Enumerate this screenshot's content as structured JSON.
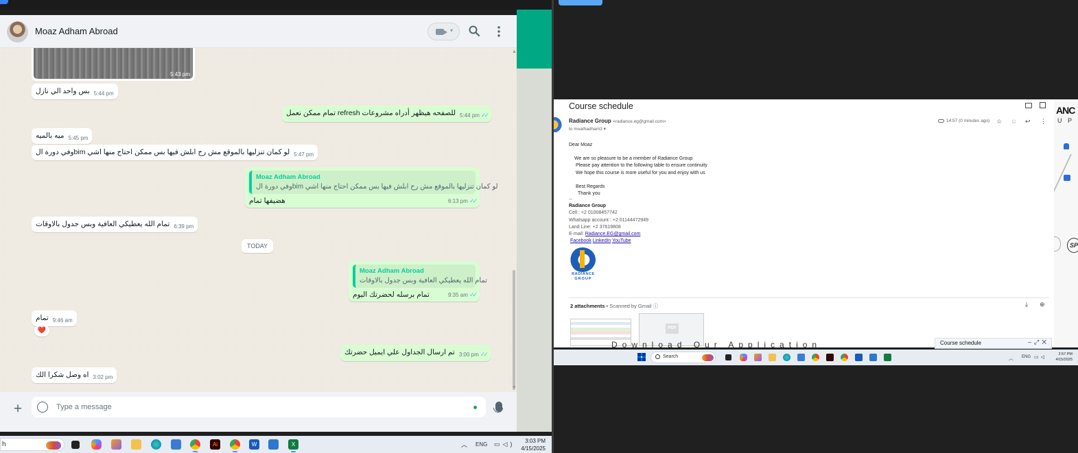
{
  "whatsapp": {
    "contact_name": "Moaz Adham Abroad",
    "image_message": {
      "time": "5:43 pm"
    },
    "messages": [
      {
        "dir": "in",
        "text": "بس واحد الي نازل",
        "time": "5:44 pm"
      },
      {
        "dir": "out",
        "text": "تمام ممكن نعمل refresh للصفحه هيظهر أدراه مشروعات",
        "time": "5:44 pm"
      },
      {
        "dir": "in",
        "text": "ميه بالميه",
        "time": "5:45 pm"
      },
      {
        "dir": "in",
        "text": "وفي دورة الbim لو كمان تنزليها بالموقع مش رح ابلش فيها بس ممكن احتاج منها اشي",
        "time": "5:47 pm"
      },
      {
        "dir": "out",
        "quote_name": "Moaz Adham Abroad",
        "quote_text": "وفي دورة الbim لو كمان تنزليها بالموقع مش رح ابلش فيها بس ممكن احتاج منها اشي",
        "text": "هضيفها تمام",
        "time": "6:13 pm"
      },
      {
        "dir": "in",
        "text": "تمام الله يعطيكي العافية وبس جدول بالاوقات",
        "time": "6:39 pm"
      },
      {
        "dir": "out",
        "quote_name": "Moaz Adham Abroad",
        "quote_text": "تمام الله يعطيكي العافية وبس جدول بالاوقات",
        "text": "تمام برسله لحضرتك اليوم",
        "time": "9:35 am"
      },
      {
        "dir": "in",
        "text": "تمام",
        "time": "9:46 am",
        "reaction": "❤️"
      },
      {
        "dir": "out",
        "text": "تم ارسال الجداول علي ايميل حضرتك",
        "time": "3:00 pm"
      },
      {
        "dir": "in",
        "text": "اه وصل شكرا الك",
        "time": "3:02 pm"
      }
    ],
    "date_divider": "TODAY",
    "compose_placeholder": "Type a message",
    "ticks": "✓✓"
  },
  "taskbar_left": {
    "search_text": "h",
    "language": "ENG",
    "time": "3:03 PM",
    "date": "4/15/2025"
  },
  "gmail": {
    "subject": "Course schedule",
    "sender_name": "Radiance Group",
    "sender_email": "<radiance.eg@gmail.com>",
    "to": "to moathadham3",
    "timestamp": "14:57 (0 minutes ago)",
    "body": {
      "greeting": "Dear  Moaz",
      "line1": "We are so pleasure to be a member of Radiance Group",
      "line2": "Please pay attention to the following table to ensure continuity",
      "line3": "We hope this course is more useful for you and enjoy with us",
      "regards": "Best Regards",
      "thanks": "Thank you",
      "sig_sep": "--",
      "sig_name": "Radiance Group",
      "cell": "Cell : +2 01008457742",
      "whatsapp": "Whatsapp account : +2 01144472949",
      "landline": "Land Line: +2 37619808",
      "email_label": "E-mail: ",
      "email_link": "Radiance.EG@gmail.com",
      "link_facebook": "Facebook",
      "link_linkedin": "LinkedIn",
      "link_youtube": "YouTube"
    },
    "logo_text_1": "RADIANCE",
    "logo_text_2": "GROUP",
    "attachments_count": "2 attachments",
    "scanned": " • Scanned by Gmail ⓘ",
    "pdf_label": "PDF",
    "download_strip": "Download Our Application",
    "minibar_title": "Course schedule",
    "side_text_1": "ANC",
    "side_text_2": "U P",
    "side_text_3": "SP"
  },
  "taskbar_right": {
    "search_label": "Search",
    "language": "ENG",
    "time": "2:57 PM",
    "date": "4/15/2025"
  },
  "colors": {
    "wa_green": "#00a884",
    "wa_out_bubble": "#d9fdd3",
    "wa_quote_bar": "#06cf9c",
    "wa_ticks": "#53bdeb",
    "gmail_link": "#1a0dab",
    "radiance_blue": "#1d5fb8",
    "radiance_gold": "#f4b400"
  }
}
